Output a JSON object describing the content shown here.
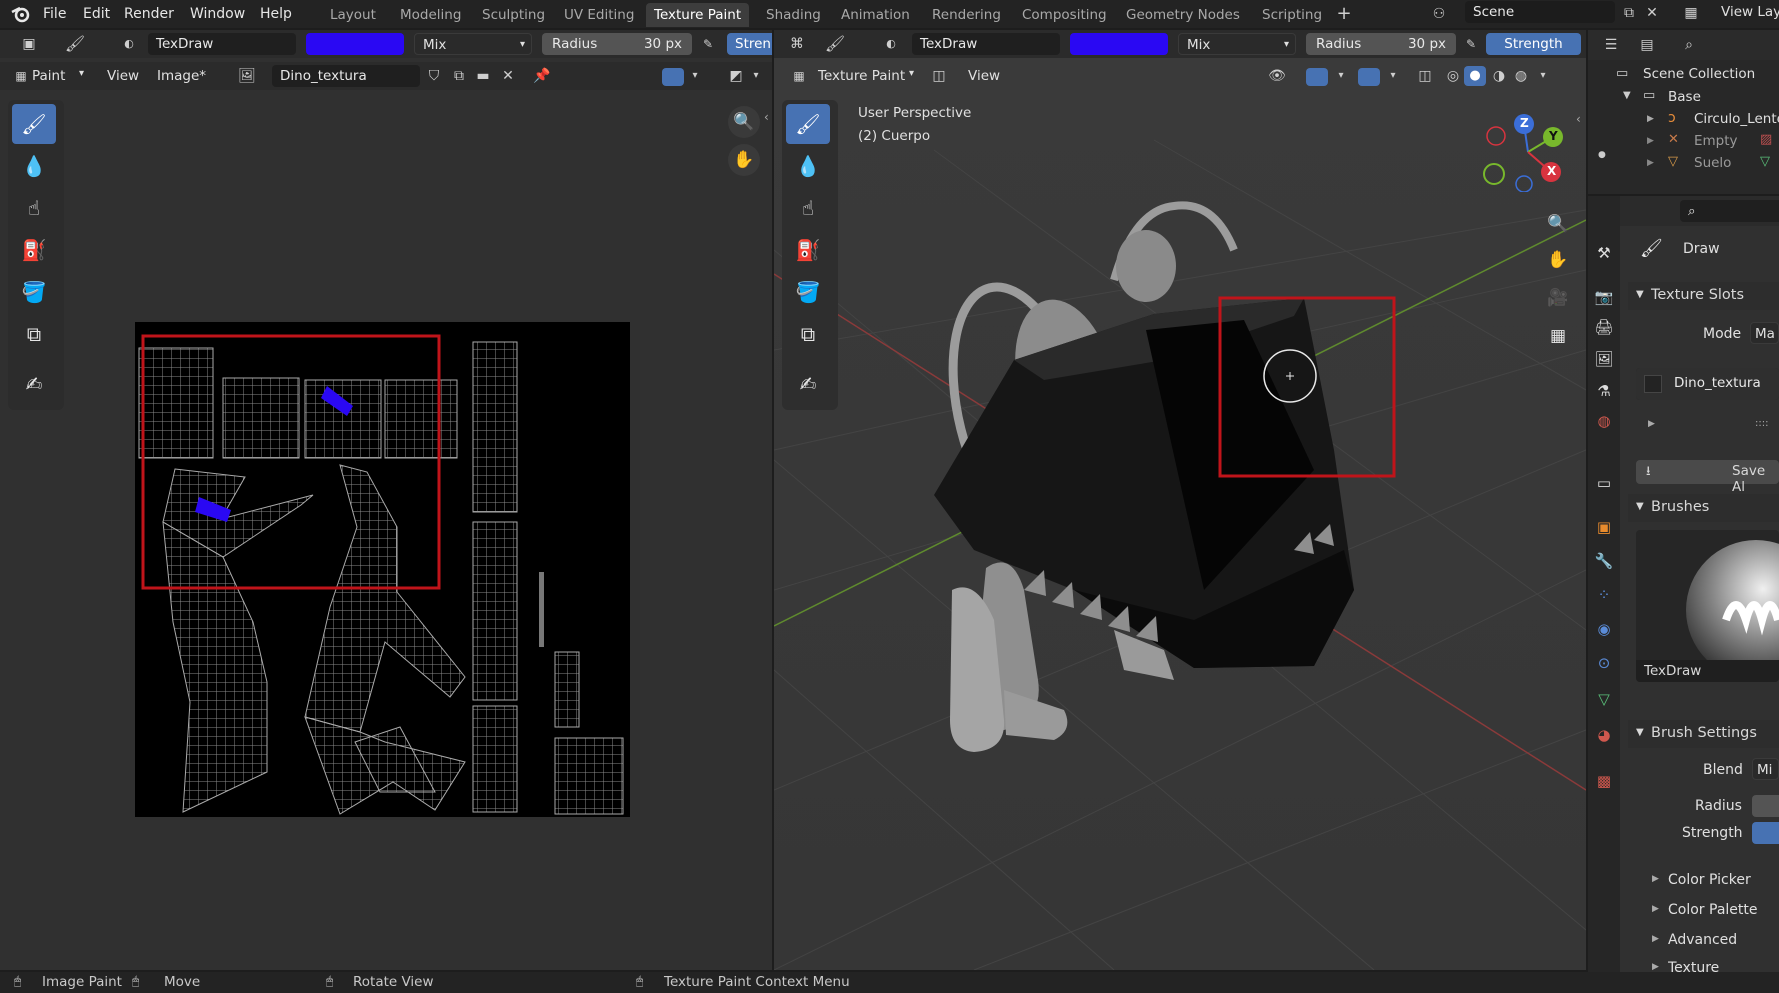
{
  "menubar": {
    "items": [
      "File",
      "Edit",
      "Render",
      "Window",
      "Help"
    ],
    "workspaces": [
      "Layout",
      "Modeling",
      "Sculpting",
      "UV Editing",
      "Texture Paint",
      "Shading",
      "Animation",
      "Rendering",
      "Compositing",
      "Geometry Nodes",
      "Scripting"
    ],
    "active_workspace": "Texture Paint",
    "scene": "Scene",
    "view_layer": "View Lay"
  },
  "colors": {
    "accent": "#4772b3",
    "brush_color": "#2a08f3",
    "highlight_box": "#c0141a"
  },
  "image_editor": {
    "brush_name": "TexDraw",
    "blend": "Mix",
    "radius_label": "Radius",
    "radius_value": "30 px",
    "strength_label": "Stren",
    "mode": "Paint",
    "menu_view": "View",
    "menu_image": "Image*",
    "image_name": "Dino_textura"
  },
  "viewport": {
    "brush_name": "TexDraw",
    "blend": "Mix",
    "radius_label": "Radius",
    "radius_value": "30 px",
    "strength_label": "Strength",
    "mode": "Texture Paint",
    "menu_view": "View",
    "overlay_title": "User Perspective",
    "overlay_object": "(2) Cuerpo",
    "gizmo": {
      "z": "Z",
      "y": "Y",
      "x": "X"
    }
  },
  "outliner": {
    "title": "Scene Collection",
    "items": [
      {
        "name": "Base"
      },
      {
        "name": "Circulo_Lente"
      },
      {
        "name": "Empty"
      },
      {
        "name": "Suelo"
      }
    ]
  },
  "properties": {
    "tool_name": "Draw",
    "texture_slots": {
      "title": "Texture Slots",
      "mode_label": "Mode",
      "mode_value": "Ma",
      "slot": "Dino_textura",
      "save_label": "Save Al"
    },
    "brushes": {
      "title": "Brushes",
      "brush_name": "TexDraw"
    },
    "brush_settings": {
      "title": "Brush Settings",
      "blend_label": "Blend",
      "blend_value": "Mi",
      "radius_label": "Radius",
      "strength_label": "Strength"
    },
    "subpanels": [
      "Color Picker",
      "Color Palette",
      "Advanced",
      "Texture"
    ]
  },
  "statusbar": {
    "left": "Image Paint",
    "middle": "Move",
    "rotate": "Rotate View",
    "right": "Texture Paint Context Menu"
  }
}
